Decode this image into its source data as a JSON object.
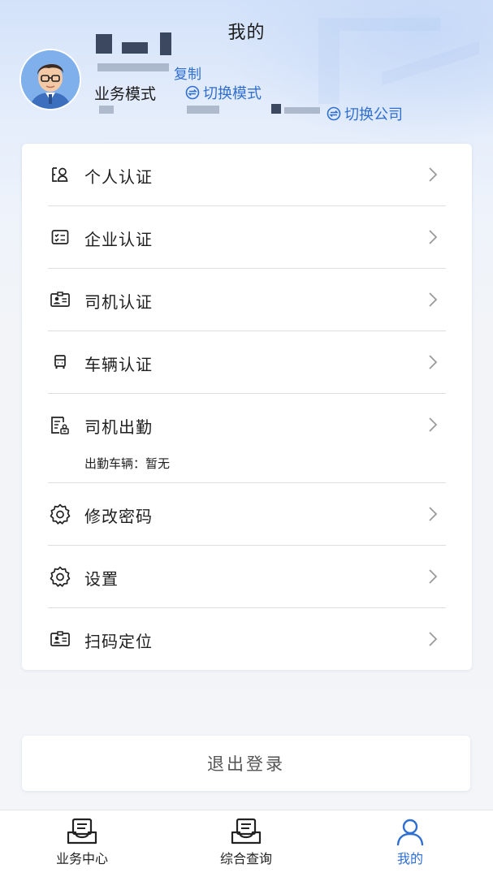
{
  "header": {
    "title": "我的",
    "copy_label": "复制",
    "mode_label": "业务模式",
    "switch_mode_label": "切换模式",
    "switch_company_label": "切换公司"
  },
  "menu": {
    "items": [
      {
        "label": "个人认证",
        "icon": "id-person-icon"
      },
      {
        "label": "企业认证",
        "icon": "enterprise-card-icon"
      },
      {
        "label": "司机认证",
        "icon": "driver-badge-icon"
      },
      {
        "label": "车辆认证",
        "icon": "vehicle-icon"
      },
      {
        "label": "司机出勤",
        "icon": "attendance-doc-icon",
        "sub": "出勤车辆：暂无"
      },
      {
        "label": "修改密码",
        "icon": "gear-icon"
      },
      {
        "label": "设置",
        "icon": "gear-icon"
      },
      {
        "label": "扫码定位",
        "icon": "driver-badge-icon"
      }
    ]
  },
  "logout_label": "退出登录",
  "tabbar": {
    "tabs": [
      {
        "label": "业务中心",
        "icon": "inbox-tray-icon"
      },
      {
        "label": "综合查询",
        "icon": "inbox-tray-icon"
      },
      {
        "label": "我的",
        "icon": "person-icon",
        "active": true
      }
    ]
  },
  "colors": {
    "accent": "#2f6fd1",
    "text": "#1f1f1f",
    "divider": "#dcdde1",
    "background": "#f3f5f9"
  }
}
